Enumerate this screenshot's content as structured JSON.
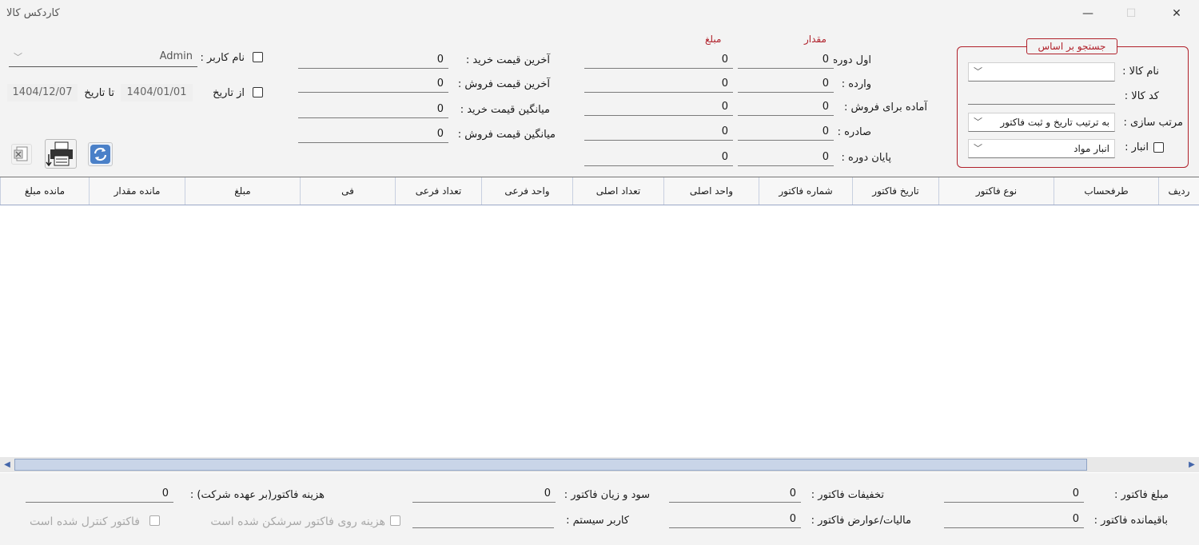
{
  "window": {
    "title": "کاردکس کالا",
    "minimize": "—",
    "maximize": "☐",
    "close": "✕"
  },
  "search": {
    "group_title": "جستجو بر اساس",
    "product_name_label": "نام کالا :",
    "product_name_value": "",
    "product_code_label": "کد کالا :",
    "product_code_value": "",
    "sort_label": "مرتب سازی :",
    "sort_value": "به ترتیب تاریخ و ثبت فاکتور",
    "warehouse_label": "انبار :",
    "warehouse_value": "انبار مواد"
  },
  "summary": {
    "col_quantity": "مقدار",
    "col_amount": "مبلغ",
    "rows": [
      {
        "label": "اول دوره :",
        "qty": "0",
        "amount": "0"
      },
      {
        "label": "وارده :",
        "qty": "0",
        "amount": "0"
      },
      {
        "label": "آماده برای فروش :",
        "qty": "0",
        "amount": "0"
      },
      {
        "label": "صادره :",
        "qty": "0",
        "amount": "0"
      },
      {
        "label": "پایان دوره :",
        "qty": "0",
        "amount": "0"
      }
    ]
  },
  "prices": [
    {
      "label": "آخرین قیمت خرید :",
      "value": "0"
    },
    {
      "label": "آخرین قیمت فروش :",
      "value": "0"
    },
    {
      "label": "میانگین قیمت خرید :",
      "value": "0"
    },
    {
      "label": "میانگین قیمت فروش :",
      "value": "0"
    }
  ],
  "filters": {
    "username_label": "نام کاربر :",
    "username_value": "Admin",
    "from_date_label": "از تاریخ",
    "from_date_value": "1404/01/01",
    "to_date_label": "تا تاریخ",
    "to_date_value": "1404/12/07"
  },
  "toolbar": {
    "excel_icon": "excel-icon",
    "print_icon": "printer-icon",
    "refresh_icon": "refresh-icon"
  },
  "grid": {
    "columns": [
      "ردیف",
      "طرفحساب",
      "نوع فاکتور",
      "تاریخ فاکتور",
      "شماره فاکتور",
      "واحد اصلی",
      "تعداد اصلی",
      "واحد فرعی",
      "تعداد فرعی",
      "فی",
      "مبلغ",
      "مانده مقدار",
      "مانده مبلغ"
    ]
  },
  "footer": {
    "invoice_amount_label": "مبلغ فاکتور :",
    "invoice_amount_value": "0",
    "invoice_discount_label": "تخفیفات فاکتور :",
    "invoice_discount_value": "0",
    "profit_loss_label": "سود و زیان فاکتور :",
    "profit_loss_value": "0",
    "invoice_cost_label": "هزینه فاکتور(بر عهده شرکت) :",
    "invoice_cost_value": "0",
    "remaining_label": "باقیمانده فاکتور :",
    "remaining_value": "0",
    "tax_label": "مالیات/عوارض فاکتور :",
    "tax_value": "0",
    "system_user_label": "کاربر سیستم :",
    "system_user_value": "",
    "cost_split_label": "هزینه روی فاکتور سرشکن شده است",
    "controlled_label": "فاکتور کنترل شده است"
  },
  "colors": {
    "accent_red": "#b0202a",
    "grid_header_line": "#9aa8c8",
    "scroll_thumb": "#c9d5e8"
  }
}
